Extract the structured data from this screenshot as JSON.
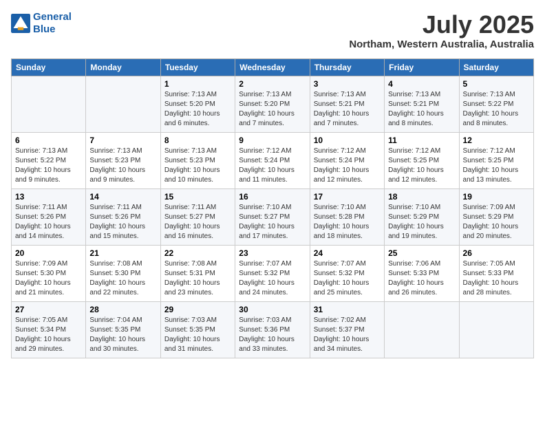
{
  "header": {
    "logo_line1": "General",
    "logo_line2": "Blue",
    "month_title": "July 2025",
    "location": "Northam, Western Australia, Australia"
  },
  "weekdays": [
    "Sunday",
    "Monday",
    "Tuesday",
    "Wednesday",
    "Thursday",
    "Friday",
    "Saturday"
  ],
  "weeks": [
    [
      {
        "day": "",
        "info": ""
      },
      {
        "day": "",
        "info": ""
      },
      {
        "day": "1",
        "info": "Sunrise: 7:13 AM\nSunset: 5:20 PM\nDaylight: 10 hours\nand 6 minutes."
      },
      {
        "day": "2",
        "info": "Sunrise: 7:13 AM\nSunset: 5:20 PM\nDaylight: 10 hours\nand 7 minutes."
      },
      {
        "day": "3",
        "info": "Sunrise: 7:13 AM\nSunset: 5:21 PM\nDaylight: 10 hours\nand 7 minutes."
      },
      {
        "day": "4",
        "info": "Sunrise: 7:13 AM\nSunset: 5:21 PM\nDaylight: 10 hours\nand 8 minutes."
      },
      {
        "day": "5",
        "info": "Sunrise: 7:13 AM\nSunset: 5:22 PM\nDaylight: 10 hours\nand 8 minutes."
      }
    ],
    [
      {
        "day": "6",
        "info": "Sunrise: 7:13 AM\nSunset: 5:22 PM\nDaylight: 10 hours\nand 9 minutes."
      },
      {
        "day": "7",
        "info": "Sunrise: 7:13 AM\nSunset: 5:23 PM\nDaylight: 10 hours\nand 9 minutes."
      },
      {
        "day": "8",
        "info": "Sunrise: 7:13 AM\nSunset: 5:23 PM\nDaylight: 10 hours\nand 10 minutes."
      },
      {
        "day": "9",
        "info": "Sunrise: 7:12 AM\nSunset: 5:24 PM\nDaylight: 10 hours\nand 11 minutes."
      },
      {
        "day": "10",
        "info": "Sunrise: 7:12 AM\nSunset: 5:24 PM\nDaylight: 10 hours\nand 12 minutes."
      },
      {
        "day": "11",
        "info": "Sunrise: 7:12 AM\nSunset: 5:25 PM\nDaylight: 10 hours\nand 12 minutes."
      },
      {
        "day": "12",
        "info": "Sunrise: 7:12 AM\nSunset: 5:25 PM\nDaylight: 10 hours\nand 13 minutes."
      }
    ],
    [
      {
        "day": "13",
        "info": "Sunrise: 7:11 AM\nSunset: 5:26 PM\nDaylight: 10 hours\nand 14 minutes."
      },
      {
        "day": "14",
        "info": "Sunrise: 7:11 AM\nSunset: 5:26 PM\nDaylight: 10 hours\nand 15 minutes."
      },
      {
        "day": "15",
        "info": "Sunrise: 7:11 AM\nSunset: 5:27 PM\nDaylight: 10 hours\nand 16 minutes."
      },
      {
        "day": "16",
        "info": "Sunrise: 7:10 AM\nSunset: 5:27 PM\nDaylight: 10 hours\nand 17 minutes."
      },
      {
        "day": "17",
        "info": "Sunrise: 7:10 AM\nSunset: 5:28 PM\nDaylight: 10 hours\nand 18 minutes."
      },
      {
        "day": "18",
        "info": "Sunrise: 7:10 AM\nSunset: 5:29 PM\nDaylight: 10 hours\nand 19 minutes."
      },
      {
        "day": "19",
        "info": "Sunrise: 7:09 AM\nSunset: 5:29 PM\nDaylight: 10 hours\nand 20 minutes."
      }
    ],
    [
      {
        "day": "20",
        "info": "Sunrise: 7:09 AM\nSunset: 5:30 PM\nDaylight: 10 hours\nand 21 minutes."
      },
      {
        "day": "21",
        "info": "Sunrise: 7:08 AM\nSunset: 5:30 PM\nDaylight: 10 hours\nand 22 minutes."
      },
      {
        "day": "22",
        "info": "Sunrise: 7:08 AM\nSunset: 5:31 PM\nDaylight: 10 hours\nand 23 minutes."
      },
      {
        "day": "23",
        "info": "Sunrise: 7:07 AM\nSunset: 5:32 PM\nDaylight: 10 hours\nand 24 minutes."
      },
      {
        "day": "24",
        "info": "Sunrise: 7:07 AM\nSunset: 5:32 PM\nDaylight: 10 hours\nand 25 minutes."
      },
      {
        "day": "25",
        "info": "Sunrise: 7:06 AM\nSunset: 5:33 PM\nDaylight: 10 hours\nand 26 minutes."
      },
      {
        "day": "26",
        "info": "Sunrise: 7:05 AM\nSunset: 5:33 PM\nDaylight: 10 hours\nand 28 minutes."
      }
    ],
    [
      {
        "day": "27",
        "info": "Sunrise: 7:05 AM\nSunset: 5:34 PM\nDaylight: 10 hours\nand 29 minutes."
      },
      {
        "day": "28",
        "info": "Sunrise: 7:04 AM\nSunset: 5:35 PM\nDaylight: 10 hours\nand 30 minutes."
      },
      {
        "day": "29",
        "info": "Sunrise: 7:03 AM\nSunset: 5:35 PM\nDaylight: 10 hours\nand 31 minutes."
      },
      {
        "day": "30",
        "info": "Sunrise: 7:03 AM\nSunset: 5:36 PM\nDaylight: 10 hours\nand 33 minutes."
      },
      {
        "day": "31",
        "info": "Sunrise: 7:02 AM\nSunset: 5:37 PM\nDaylight: 10 hours\nand 34 minutes."
      },
      {
        "day": "",
        "info": ""
      },
      {
        "day": "",
        "info": ""
      }
    ]
  ]
}
